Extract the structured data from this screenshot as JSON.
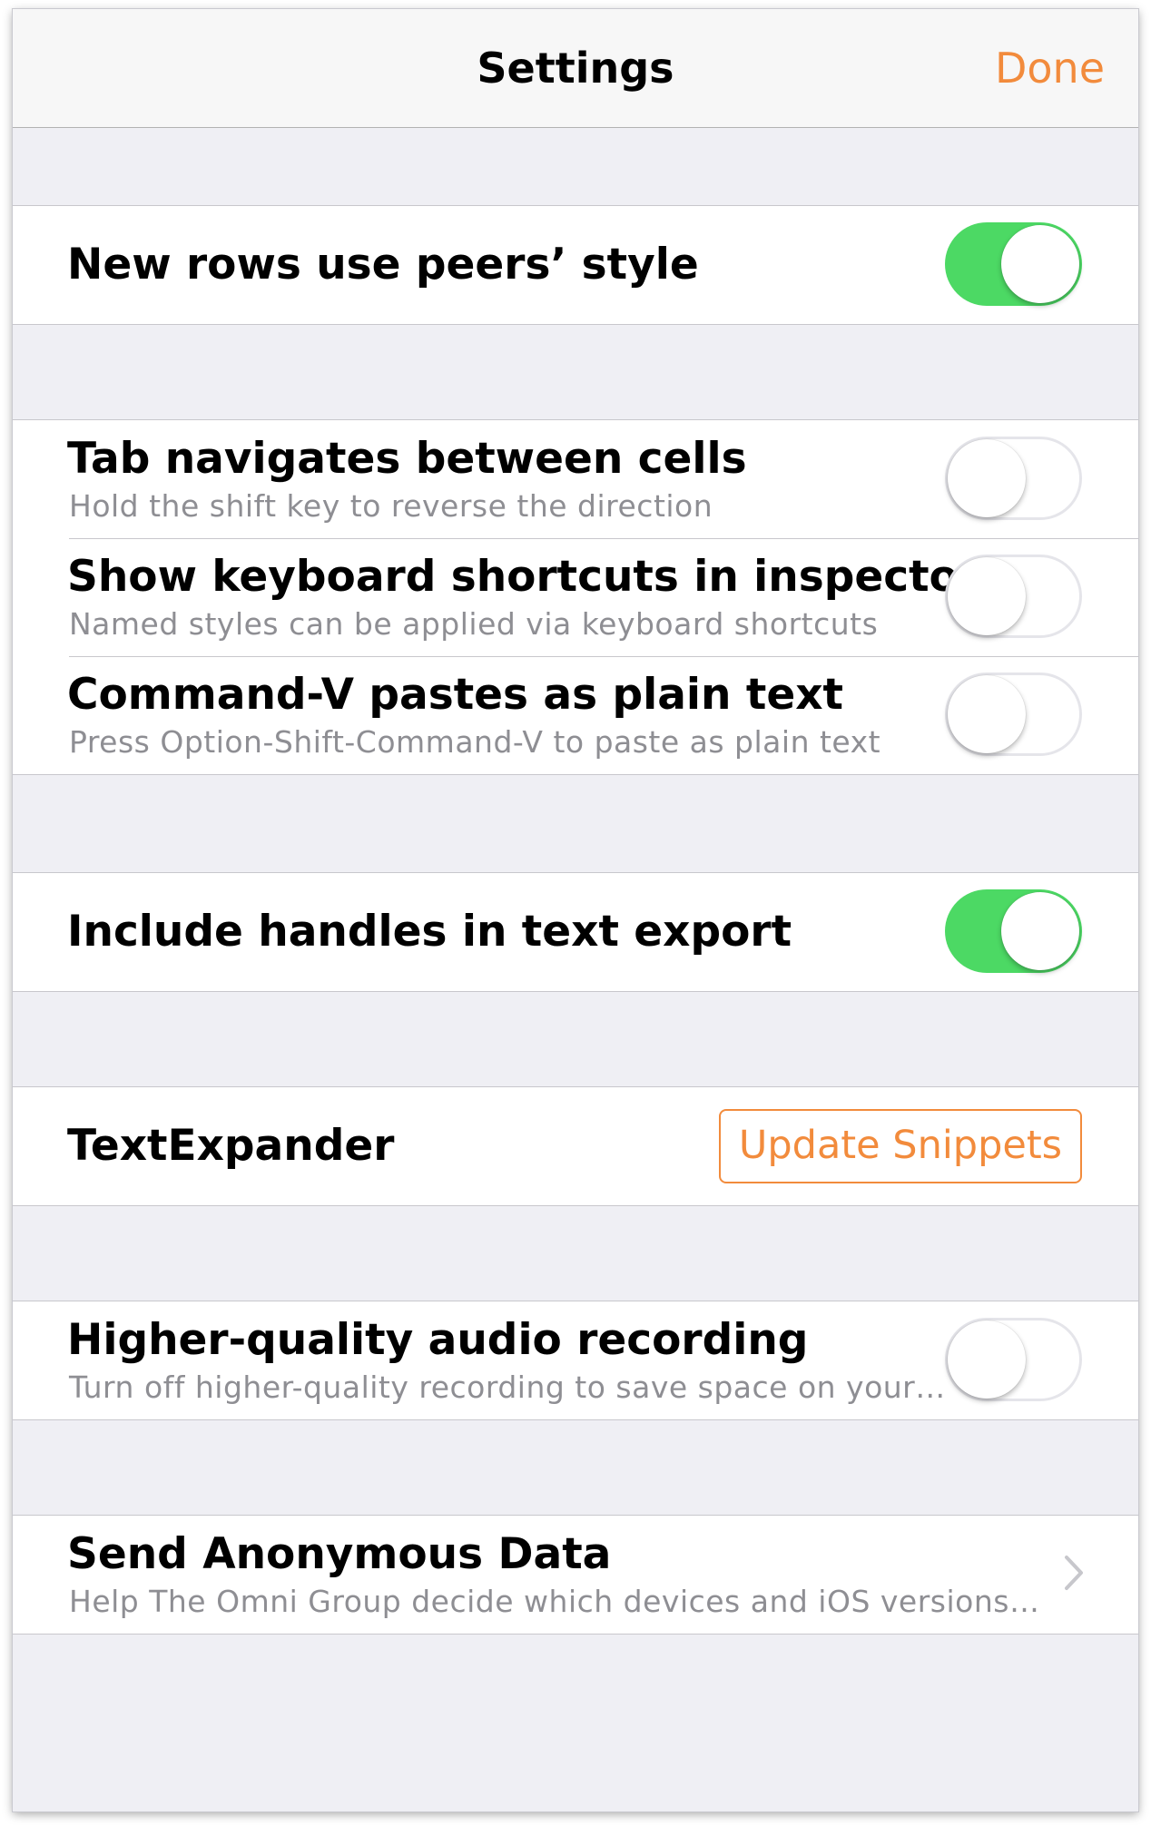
{
  "navbar": {
    "title": "Settings",
    "done_label": "Done"
  },
  "settings": {
    "new_rows_peers_style": {
      "title": "New rows use peers’ style",
      "enabled": true
    },
    "tab_navigates": {
      "title": "Tab navigates between cells",
      "subtitle": "Hold the shift key to reverse the direction",
      "enabled": false
    },
    "keyboard_shortcuts": {
      "title": "Show keyboard shortcuts in inspectors",
      "subtitle": "Named styles can be applied via keyboard shortcuts",
      "enabled": false
    },
    "command_v_plain": {
      "title": "Command-V pastes as plain text",
      "subtitle": "Press Option-Shift-Command-V to paste as plain text",
      "enabled": false
    },
    "include_handles": {
      "title": "Include handles in text export",
      "enabled": true
    },
    "textexpander": {
      "title": "TextExpander",
      "button_label": "Update Snippets"
    },
    "audio_quality": {
      "title": "Higher-quality audio recording",
      "subtitle": "Turn off higher-quality recording to save space on your…",
      "enabled": false
    },
    "anonymous_data": {
      "title": "Send Anonymous Data",
      "subtitle": "Help The Omni Group decide which devices and iOS versions…"
    }
  },
  "colors": {
    "accent": "#f28b3c",
    "toggle_on": "#4cd964",
    "background": "#efeff4",
    "subtitle": "#8e8e93"
  }
}
